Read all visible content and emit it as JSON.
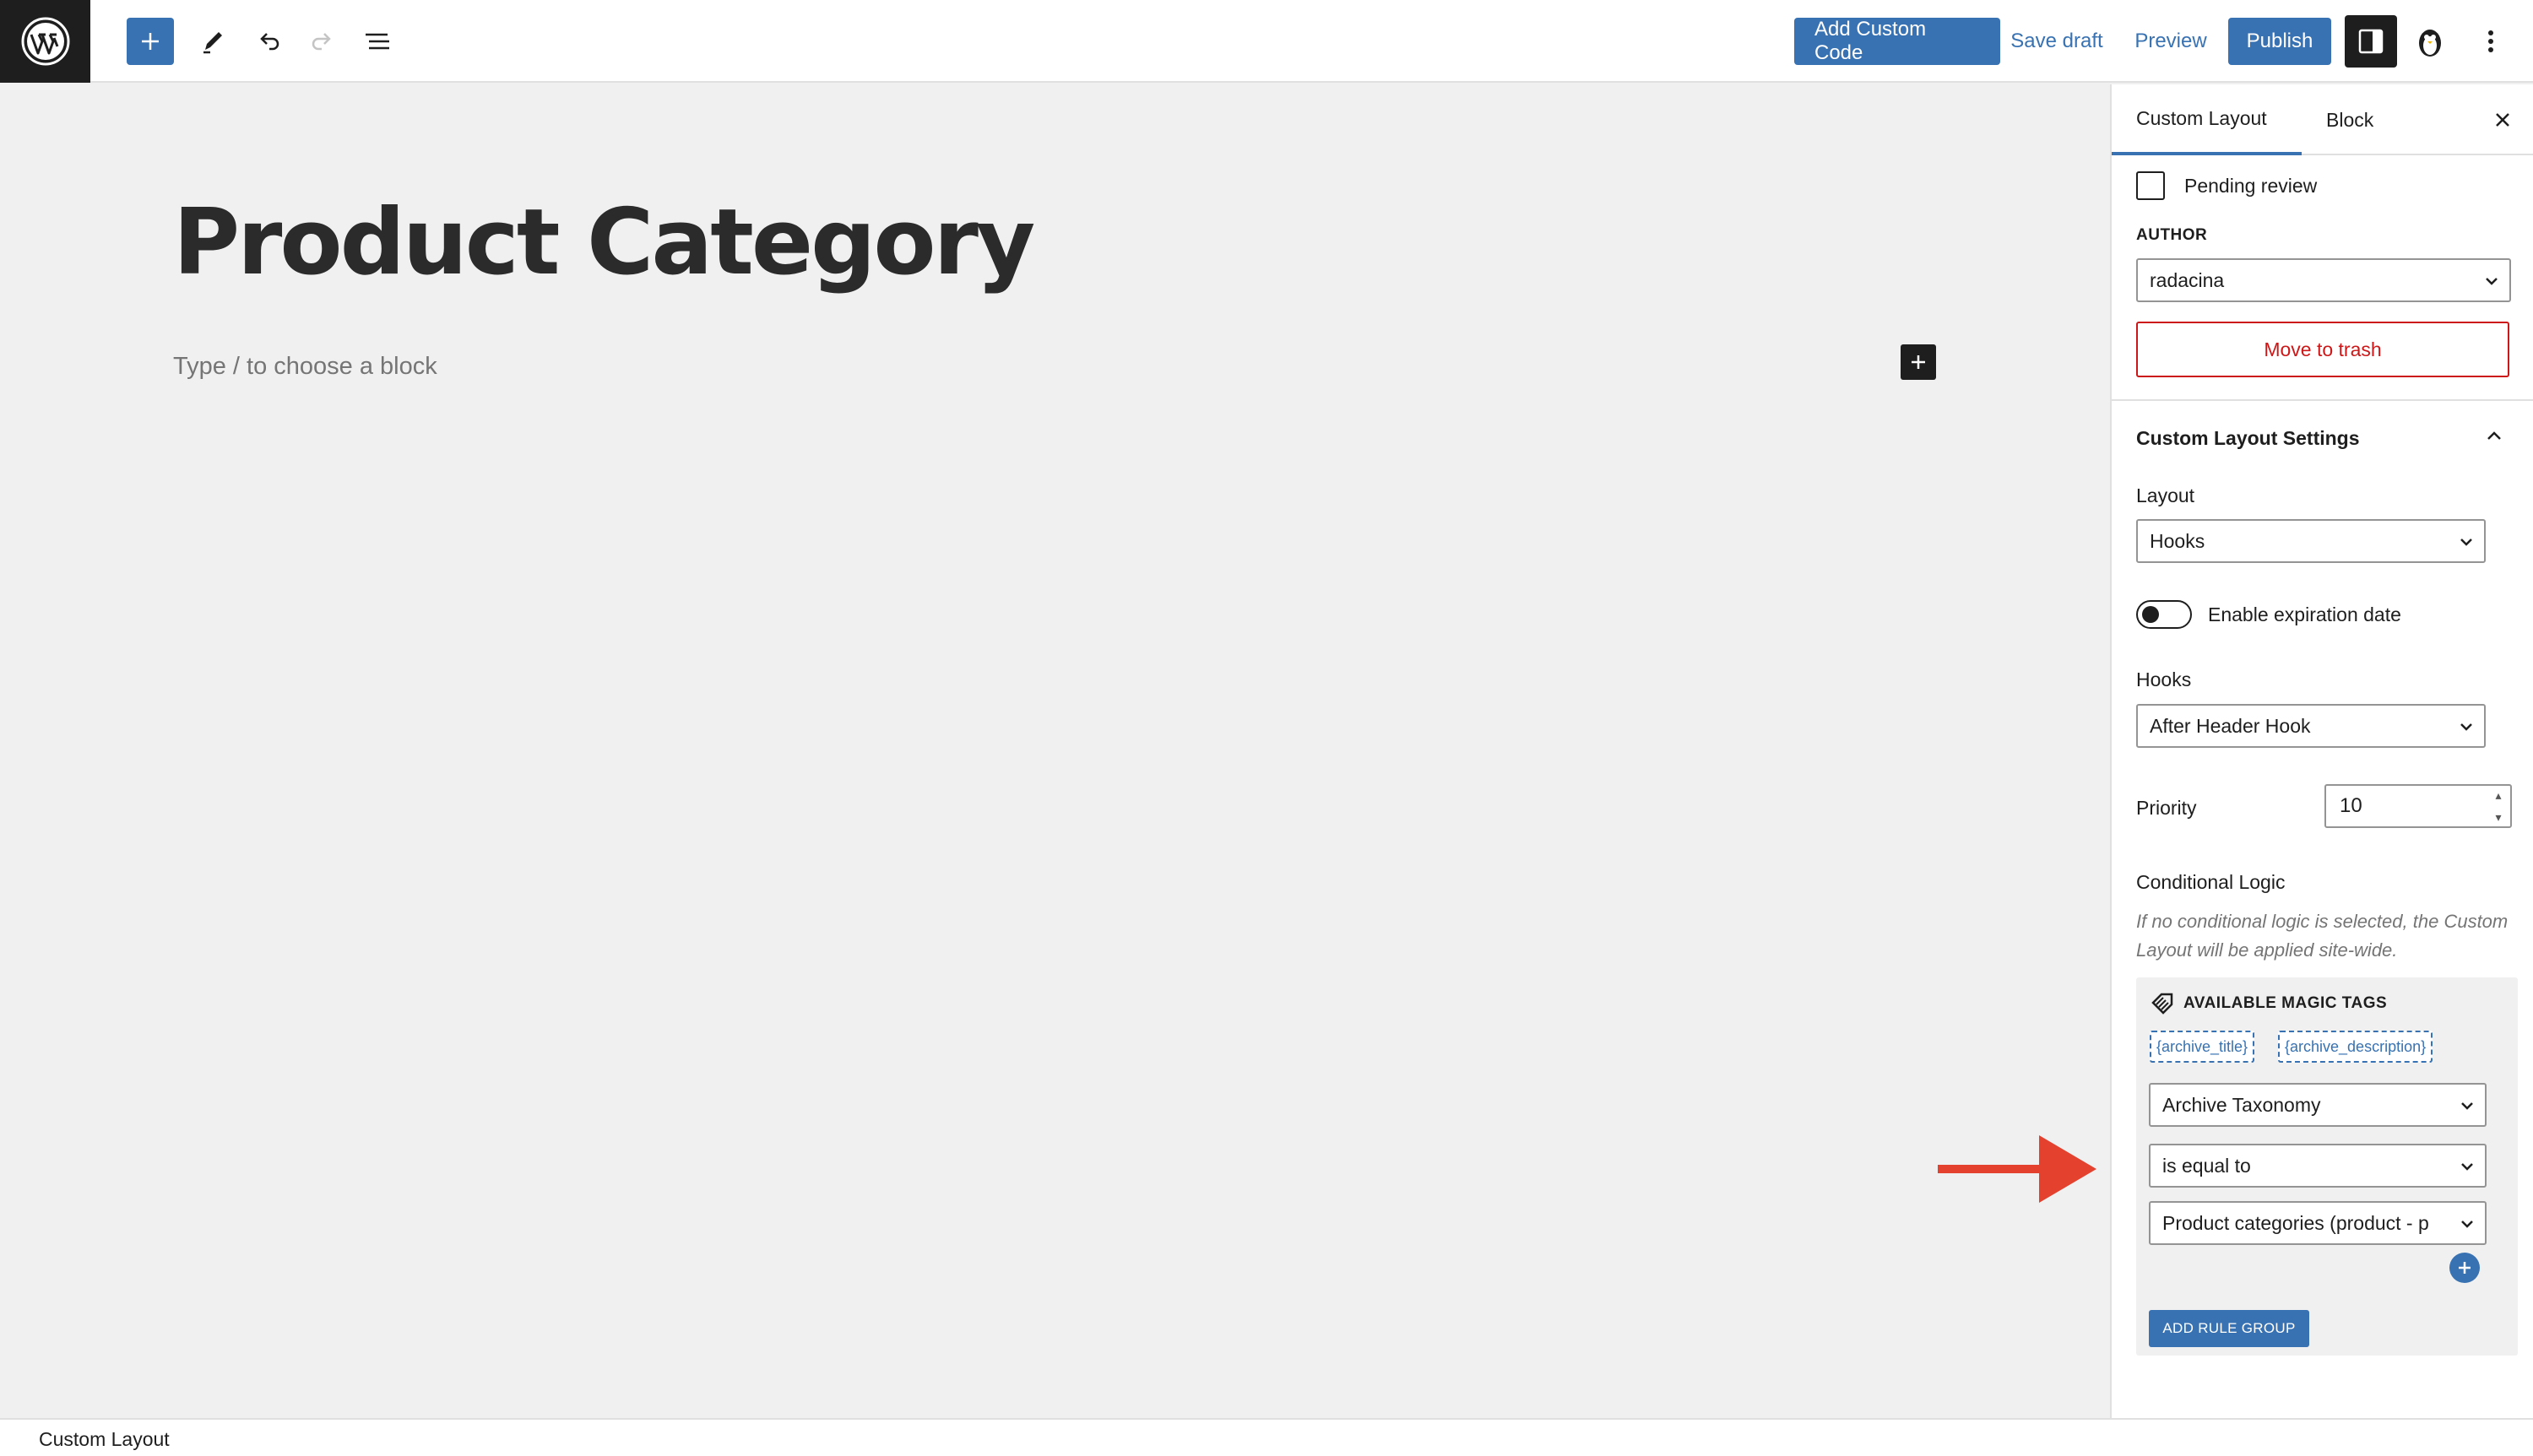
{
  "toolbar": {
    "add_custom_code": "Add Custom Code",
    "save_draft": "Save draft",
    "preview": "Preview",
    "publish": "Publish"
  },
  "editor": {
    "title": "Product Category",
    "placeholder": "Type / to choose a block"
  },
  "sidebar": {
    "tabs": [
      "Custom Layout",
      "Block"
    ],
    "pending_review": "Pending review",
    "author_label": "AUTHOR",
    "author_value": "radacina",
    "move_to_trash": "Move to trash",
    "section_title": "Custom Layout Settings",
    "layout_label": "Layout",
    "layout_value": "Hooks",
    "expiration_label": "Enable expiration date",
    "hooks_label": "Hooks",
    "hooks_value": "After Header Hook",
    "priority_label": "Priority",
    "priority_value": "10",
    "conditional_label": "Conditional Logic",
    "conditional_hint": "If no conditional logic is selected, the Custom Layout will be applied site-wide.",
    "magic_tags_label": "AVAILABLE MAGIC TAGS",
    "magic_tags": [
      "{archive_title}",
      "{archive_description}"
    ],
    "rule_param": "Archive Taxonomy",
    "rule_operator": "is equal to",
    "rule_value": "Product categories (product - p",
    "add_rule_group": "ADD RULE GROUP"
  },
  "footer": {
    "breadcrumb": "Custom Layout"
  },
  "colors": {
    "accent": "#3872b2",
    "danger": "#cc1818",
    "arrow": "#e5412f"
  }
}
